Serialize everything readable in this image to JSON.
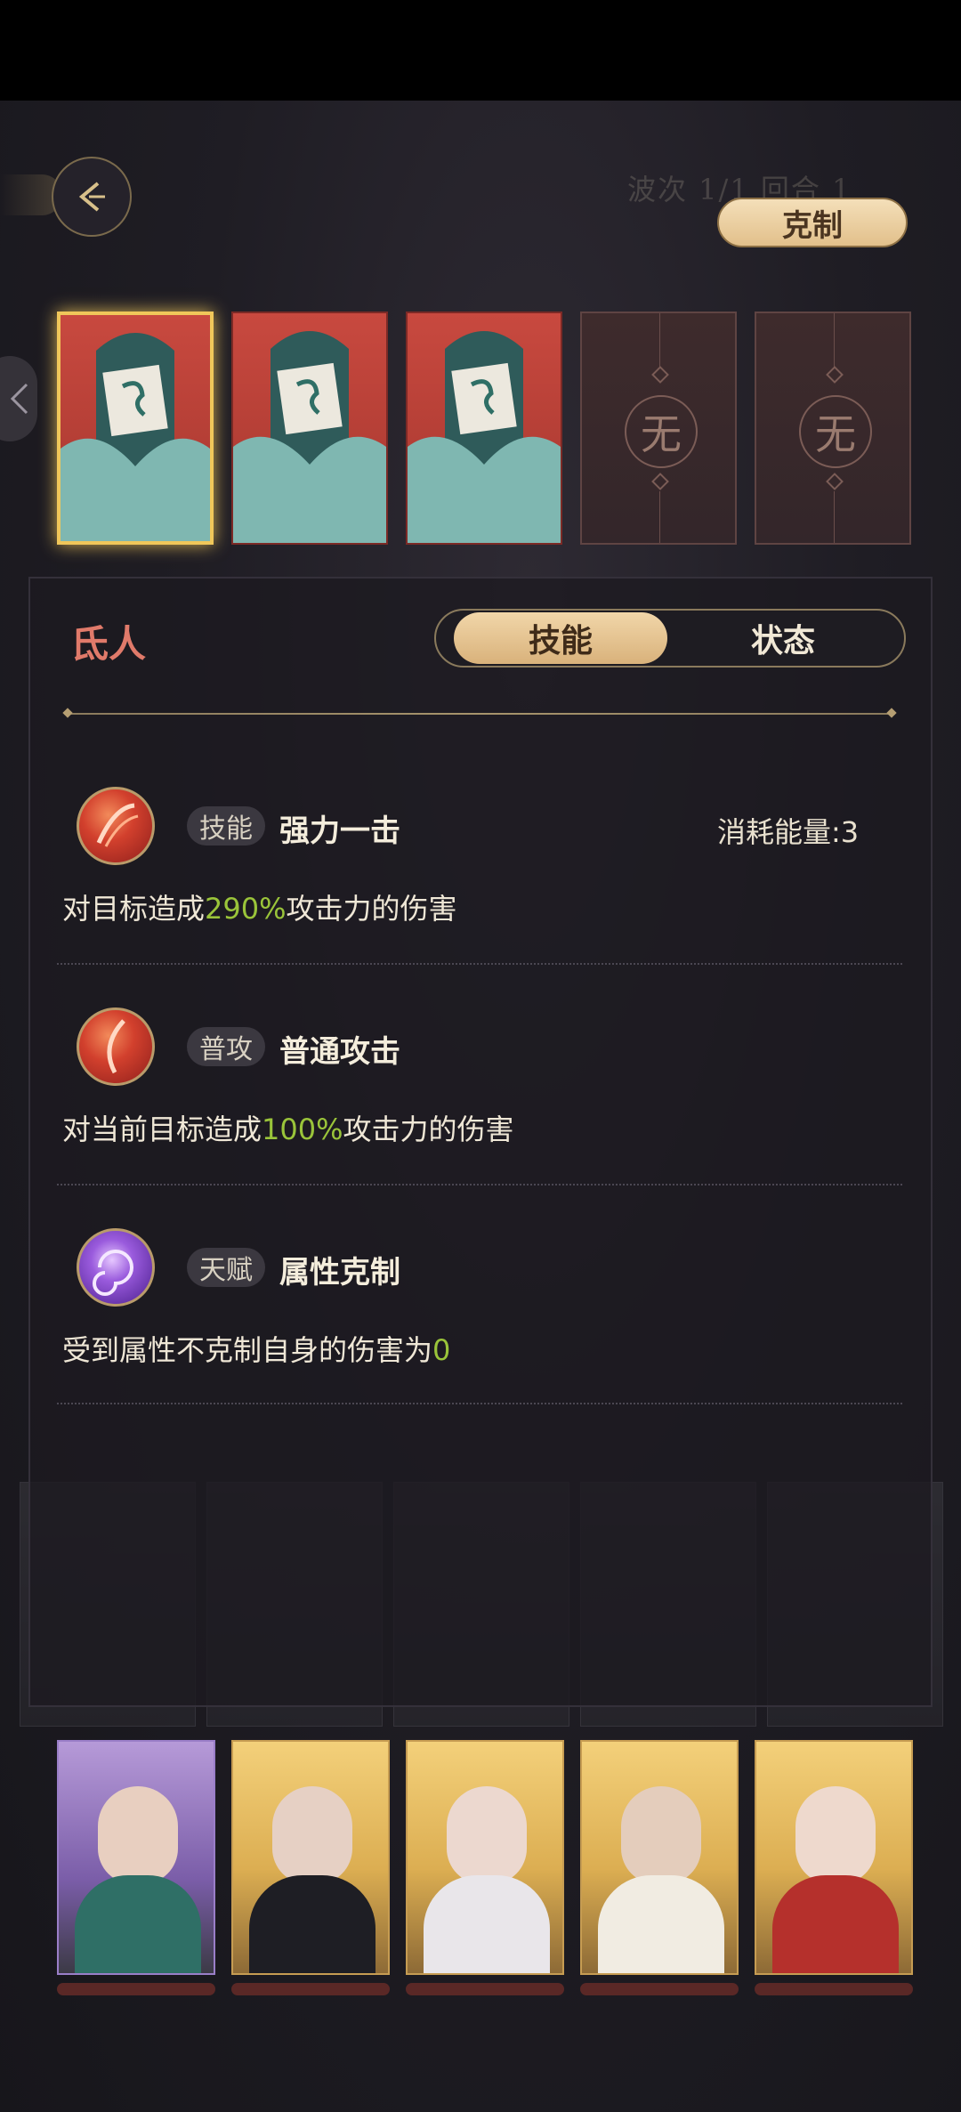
{
  "header": {
    "wave_text": "波次  1/1  回合 1",
    "counter_button": "克制"
  },
  "team_slots": [
    {
      "state": "filled",
      "selected": true
    },
    {
      "state": "filled",
      "selected": false
    },
    {
      "state": "filled",
      "selected": false
    },
    {
      "state": "empty",
      "label": "无"
    },
    {
      "state": "empty",
      "label": "无"
    }
  ],
  "panel": {
    "character_name": "氐人",
    "tabs": [
      {
        "label": "技能",
        "active": true
      },
      {
        "label": "状态",
        "active": false
      }
    ],
    "skills": [
      {
        "tag": "技能",
        "name": "强力一击",
        "cost": "消耗能量:3",
        "desc_pre": "对目标造成",
        "desc_value": "290%",
        "desc_post": "攻击力的伤害",
        "icon": "slash-icon"
      },
      {
        "tag": "普攻",
        "name": "普通攻击",
        "cost": "",
        "desc_pre": "对当前目标造成",
        "desc_value": "100%",
        "desc_post": "攻击力的伤害",
        "icon": "strike-icon"
      },
      {
        "tag": "天赋",
        "name": "属性克制",
        "cost": "",
        "desc_pre": "受到属性不克制自身的伤害为",
        "desc_value": "0",
        "desc_post": "",
        "icon": "vortex-icon"
      }
    ]
  },
  "colors": {
    "accent_gold": "#e2c08b",
    "highlight_green": "#9ac43a",
    "enemy_name": "#e07a6a"
  }
}
